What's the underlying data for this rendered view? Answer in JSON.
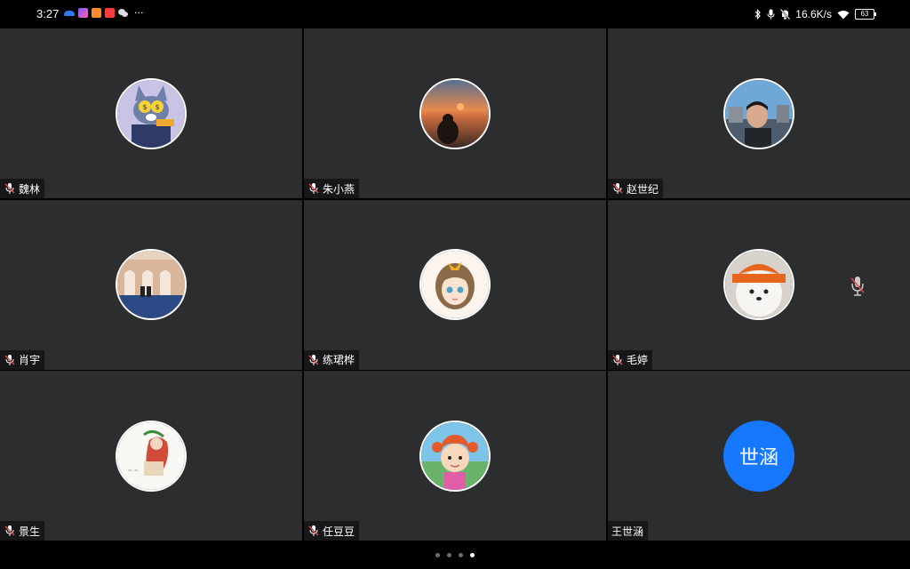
{
  "status_bar": {
    "time": "3:27",
    "network_speed": "16.6K/s",
    "battery": "63",
    "left_icons": [
      "cloud-icon",
      "app-icon",
      "video-app-icon",
      "red-app-icon",
      "wechat-icon",
      "more-icon"
    ],
    "right_icons": [
      "bluetooth-icon",
      "microphone-icon",
      "mute-notification-icon",
      "wifi-icon",
      "battery-icon"
    ]
  },
  "participants": [
    {
      "name": "魏林",
      "avatar": "cat-cartoon-avatar",
      "muted": true
    },
    {
      "name": "朱小燕",
      "avatar": "sunset-photo-avatar",
      "muted": true
    },
    {
      "name": "赵世纪",
      "avatar": "man-photo-avatar",
      "muted": true
    },
    {
      "name": "肖宇",
      "avatar": "building-photo-avatar",
      "muted": true
    },
    {
      "name": "练珺桦",
      "avatar": "anime-girl-avatar",
      "muted": true
    },
    {
      "name": "毛婷",
      "avatar": "dog-photo-avatar",
      "muted": true
    },
    {
      "name": "景生",
      "avatar": "illustration-avatar",
      "muted": true
    },
    {
      "name": "任豆豆",
      "avatar": "cartoon-girl-avatar",
      "muted": true
    },
    {
      "name": "王世涵",
      "avatar_text": "世涵",
      "muted": false
    }
  ],
  "pager": {
    "total": 4,
    "active": 4
  },
  "colors": {
    "tile_bg": "#2c2d2f",
    "muted_mic": "#e5484d",
    "text_avatar_bg": "#1677ff"
  }
}
